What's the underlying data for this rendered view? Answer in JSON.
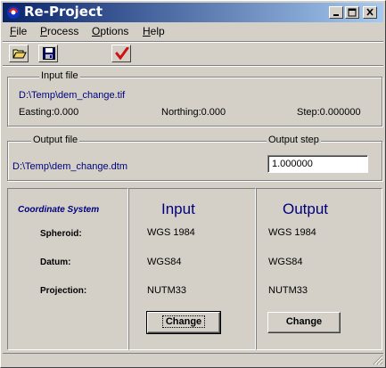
{
  "window": {
    "title": "Re-Project",
    "controls": {
      "minimize": "minimize-icon",
      "maximize": "maximize-icon",
      "close": "close-icon"
    }
  },
  "menu": [
    {
      "label": "File",
      "accel": "F",
      "rest": "ile"
    },
    {
      "label": "Process",
      "accel": "P",
      "rest": "rocess"
    },
    {
      "label": "Options",
      "accel": "O",
      "rest": "ptions"
    },
    {
      "label": "Help",
      "accel": "H",
      "rest": "elp"
    }
  ],
  "toolbar": {
    "open": "folder-open-icon",
    "save": "save-icon",
    "run": "checkmark-icon"
  },
  "input_file": {
    "group_label": "Input file",
    "path": "D:\\Temp\\dem_change.tif",
    "easting": "Easting:0.000",
    "northing": "Northing:0.000",
    "step": "Step:0.000000"
  },
  "output_file": {
    "group_label": "Output file",
    "path": "D:\\Temp\\dem_change.dtm",
    "step_label": "Output step",
    "step_value": "1.000000"
  },
  "coordinate_system": {
    "title": "Coordinate System",
    "rows": [
      "Spheroid:",
      "Datum:",
      "Projection:"
    ],
    "input": {
      "heading": "Input",
      "spheroid": "WGS 1984",
      "datum": "WGS84",
      "projection": "NUTM33",
      "button": "Change"
    },
    "output": {
      "heading": "Output",
      "spheroid": "WGS 1984",
      "datum": "WGS84",
      "projection": "NUTM33",
      "button": "Change"
    }
  },
  "colors": {
    "titlebar_start": "#0a246a",
    "titlebar_end": "#a6caf0",
    "accent_text": "#00007b",
    "face": "#d4d0c8"
  }
}
